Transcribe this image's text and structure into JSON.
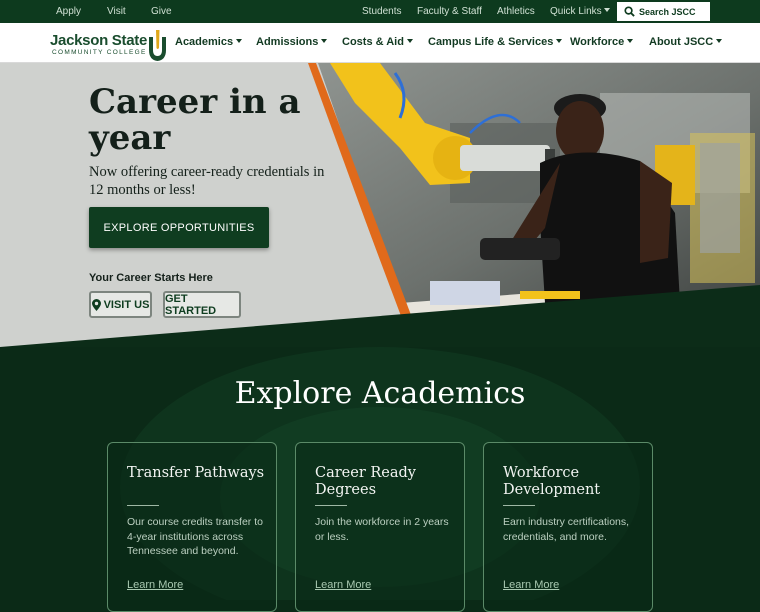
{
  "topbar": {
    "left_links": [
      "Apply",
      "Visit",
      "Give"
    ],
    "right_links": [
      "Students",
      "Faculty & Staff",
      "Athletics"
    ],
    "quick_links": "Quick Links",
    "search_label": "Search JSCC"
  },
  "logo": {
    "line1": "Jackson State",
    "line2": "COMMUNITY COLLEGE"
  },
  "nav": {
    "items": [
      "Academics",
      "Admissions",
      "Costs & Aid",
      "Campus Life & Services",
      "Workforce",
      "About JSCC"
    ]
  },
  "hero": {
    "title": "Career in a year",
    "subtitle": "Now offering career-ready credentials in 12 months or less!",
    "cta": "Explore Opportunities",
    "starts_label": "Your Career Starts Here",
    "visit_label": "Visit Us",
    "started_label": "Get Started"
  },
  "academics": {
    "title": "Explore Academics",
    "cards": [
      {
        "title": "Transfer Pathways",
        "desc": "Our course credits transfer to 4-year institutions across Tennessee and beyond.",
        "link": "Learn More"
      },
      {
        "title": "Career Ready Degrees",
        "desc": "Join the workforce in 2 years or less.",
        "link": "Learn More"
      },
      {
        "title": "Workforce Development",
        "desc": "Earn industry certifications, credentials, and more.",
        "link": "Learn More"
      }
    ]
  },
  "colors": {
    "brand_green": "#0f3d20",
    "accent_orange": "#e06a1b",
    "robot_yellow": "#f2c21b"
  }
}
